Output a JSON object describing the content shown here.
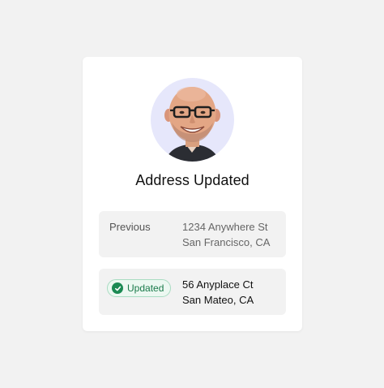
{
  "card": {
    "title": "Address Updated",
    "avatar_alt": "profile photo"
  },
  "previous": {
    "label": "Previous",
    "address_line1": "1234 Anywhere St",
    "address_line2": "San Francisco, CA"
  },
  "updated": {
    "badge_label": "Updated",
    "badge_icon": "check-circle-icon",
    "address_line1": "56 Anyplace Ct",
    "address_line2": "San Mateo, CA"
  },
  "colors": {
    "background": "#f2f2f2",
    "card": "#ffffff",
    "avatar_bg": "#e6e7fb",
    "badge_bg": "#ecf8f1",
    "badge_border": "#a9dcc2",
    "badge_accent": "#1b8a53"
  }
}
